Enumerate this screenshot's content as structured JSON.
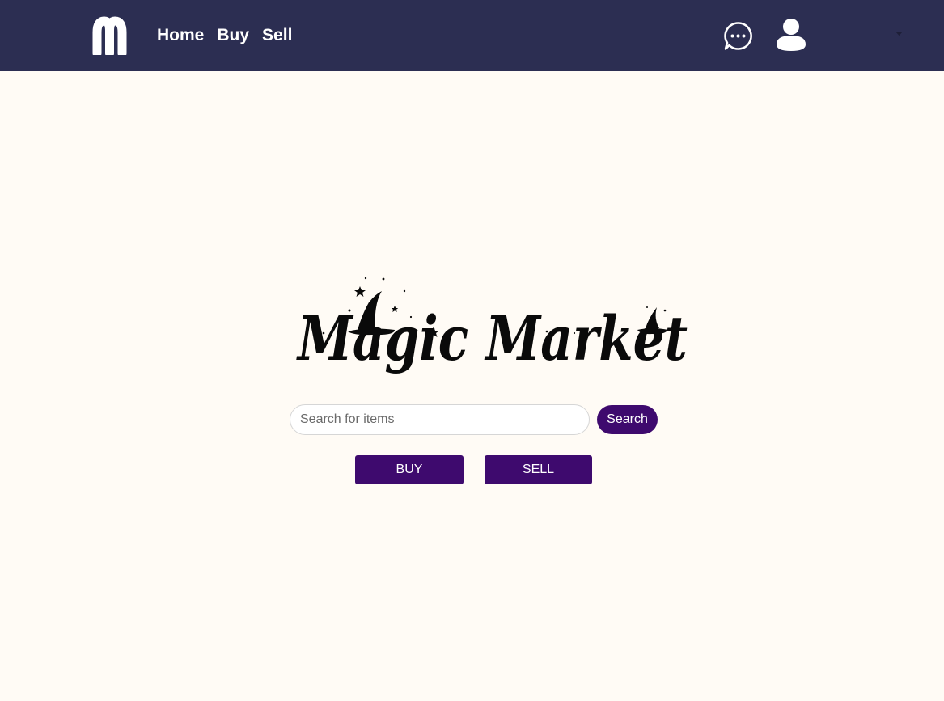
{
  "nav": {
    "logo_icon": "m-logo-icon",
    "links": [
      "Home",
      "Buy",
      "Sell"
    ],
    "chat_icon": "chat-bubble-icon",
    "profile_icon": "user-icon",
    "caret_icon": "caret-down-icon"
  },
  "hero": {
    "logo_text": "Magic Market",
    "search": {
      "placeholder": "Search for items",
      "value": "",
      "button_label": "Search"
    },
    "buy_label": "BUY",
    "sell_label": "SELL"
  },
  "colors": {
    "navbar_bg": "#2c2e52",
    "page_bg": "#fffbf5",
    "accent": "#3e0a6e",
    "nav_text": "#ffffff"
  }
}
